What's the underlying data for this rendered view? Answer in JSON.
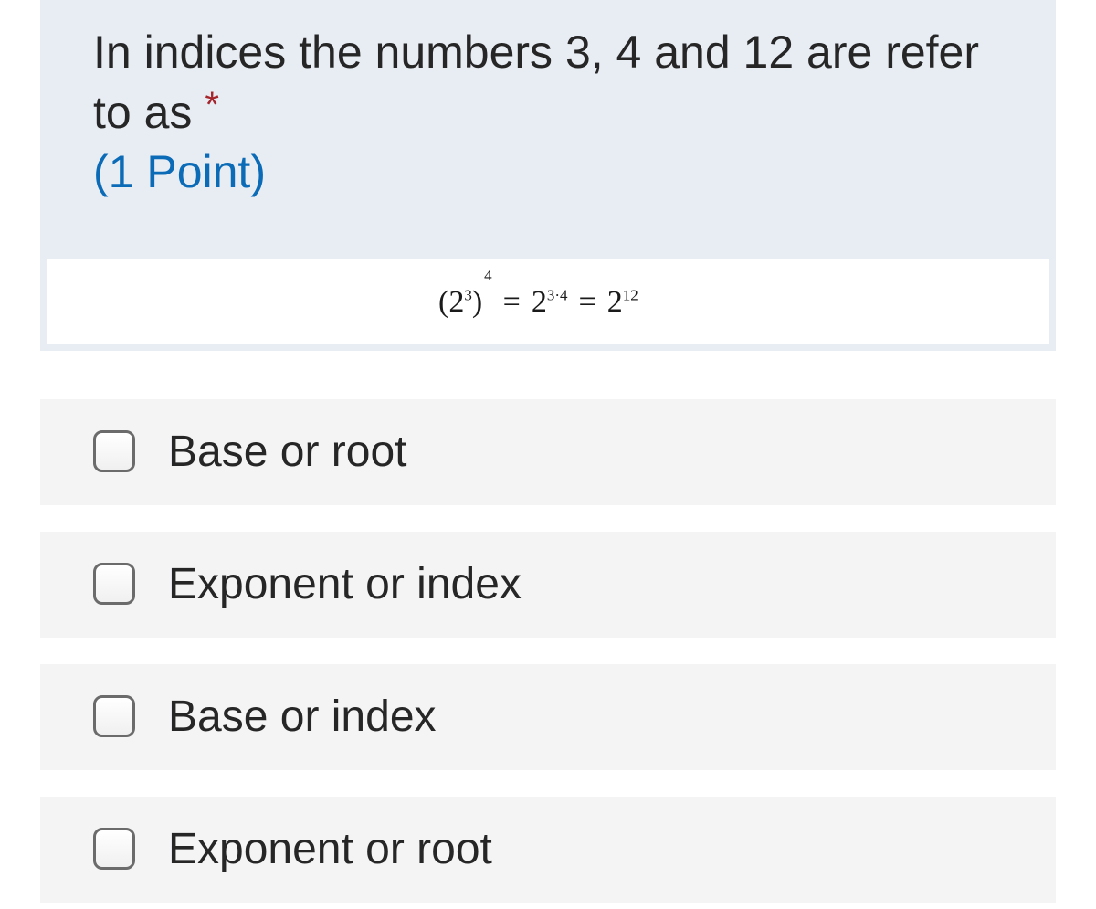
{
  "question": {
    "text": "In indices the numbers 3, 4 and 12 are refer to as",
    "required_marker": "*",
    "points": "(1 Point)"
  },
  "formula": {
    "left_open": "(2",
    "left_inner_exp": "3",
    "left_close": ")",
    "left_outer_exp": "4",
    "eq1": "=",
    "mid_base": "2",
    "mid_exp": "3·4",
    "eq2": "=",
    "right_base": "2",
    "right_exp": "12"
  },
  "options": [
    {
      "label": "Base or root",
      "checked": false
    },
    {
      "label": "Exponent or index",
      "checked": false
    },
    {
      "label": "Base or index",
      "checked": false
    },
    {
      "label": "Exponent or root",
      "checked": false
    }
  ],
  "colors": {
    "question_bg": "#e8edf4",
    "option_bg": "#f4f4f5",
    "points_blue": "#0b6bb6",
    "required_red": "#a4262c"
  }
}
